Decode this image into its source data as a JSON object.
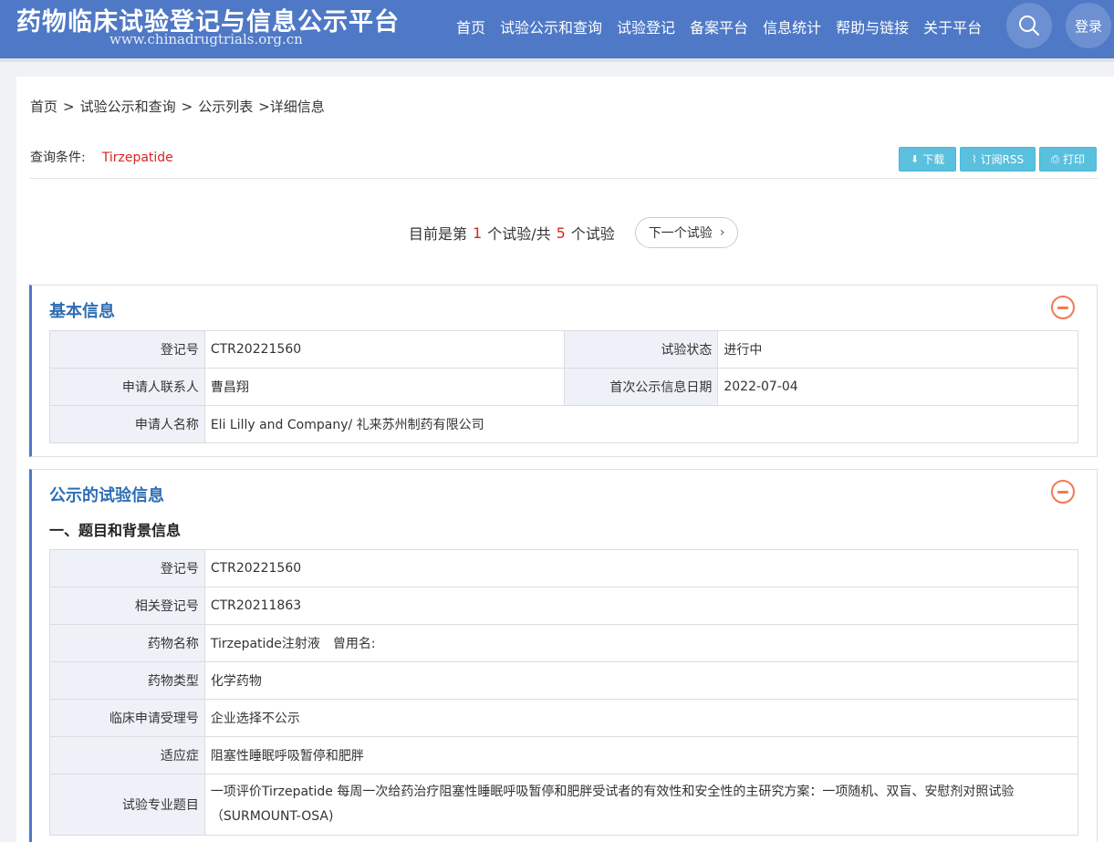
{
  "header": {
    "title": "药物临床试验登记与信息公示平台",
    "url": "www.chinadrugtrials.org.cn",
    "nav": [
      "首页",
      "试验公示和查询",
      "试验登记",
      "备案平台",
      "信息统计",
      "帮助与链接",
      "关于平台"
    ],
    "login": "登录"
  },
  "breadcrumb": [
    "首页",
    "试验公示和查询",
    "公示列表",
    ">详细信息"
  ],
  "query": {
    "label": "查询条件:",
    "value": "Tirzepatide"
  },
  "buttons": {
    "download": "下载",
    "rss": "订阅RSS",
    "print": "打印"
  },
  "pager": {
    "prefix": "目前是第",
    "current": "1",
    "middle": "个试验/共",
    "total": "5",
    "suffix": "个试验",
    "next": "下一个试验"
  },
  "basic": {
    "title": "基本信息",
    "rows": [
      {
        "l1": "登记号",
        "v1": "CTR20221560",
        "l2": "试验状态",
        "v2": "进行中"
      },
      {
        "l1": "申请人联系人",
        "v1": "曹昌翔",
        "l2": "首次公示信息日期",
        "v2": "2022-07-04"
      }
    ],
    "applicant_label": "申请人名称",
    "applicant_value": "Eli Lilly and Company/ 礼来苏州制药有限公司"
  },
  "trial": {
    "title": "公示的试验信息",
    "subtitle": "一、题目和背景信息",
    "rows": [
      {
        "label": "登记号",
        "value": "CTR20221560"
      },
      {
        "label": "相关登记号",
        "value": "CTR20211863"
      },
      {
        "label": "药物名称",
        "value": "Tirzepatide注射液　曾用名:"
      },
      {
        "label": "药物类型",
        "value": "化学药物"
      },
      {
        "label": "临床申请受理号",
        "value": "企业选择不公示"
      },
      {
        "label": "适应症",
        "value": "阻塞性睡眠呼吸暂停和肥胖"
      },
      {
        "label": "试验专业题目",
        "value": "一项评价Tirzepatide 每周一次给药治疗阻塞性睡眠呼吸暂停和肥胖受试者的有效性和安全性的主研究方案：一项随机、双盲、安慰剂对照试验（SURMOUNT-OSA)"
      }
    ]
  },
  "icons": {
    "search": "search-icon",
    "download": "download-icon",
    "rss": "rss-icon",
    "print": "print-icon",
    "collapse": "minus-circle-icon",
    "next": "chevron-right-icon"
  },
  "colors": {
    "header": "#4f79c6",
    "accent": "#2e6db4",
    "highlight": "#d9251d",
    "button": "#5bc0de",
    "collapse": "#f07a55"
  }
}
